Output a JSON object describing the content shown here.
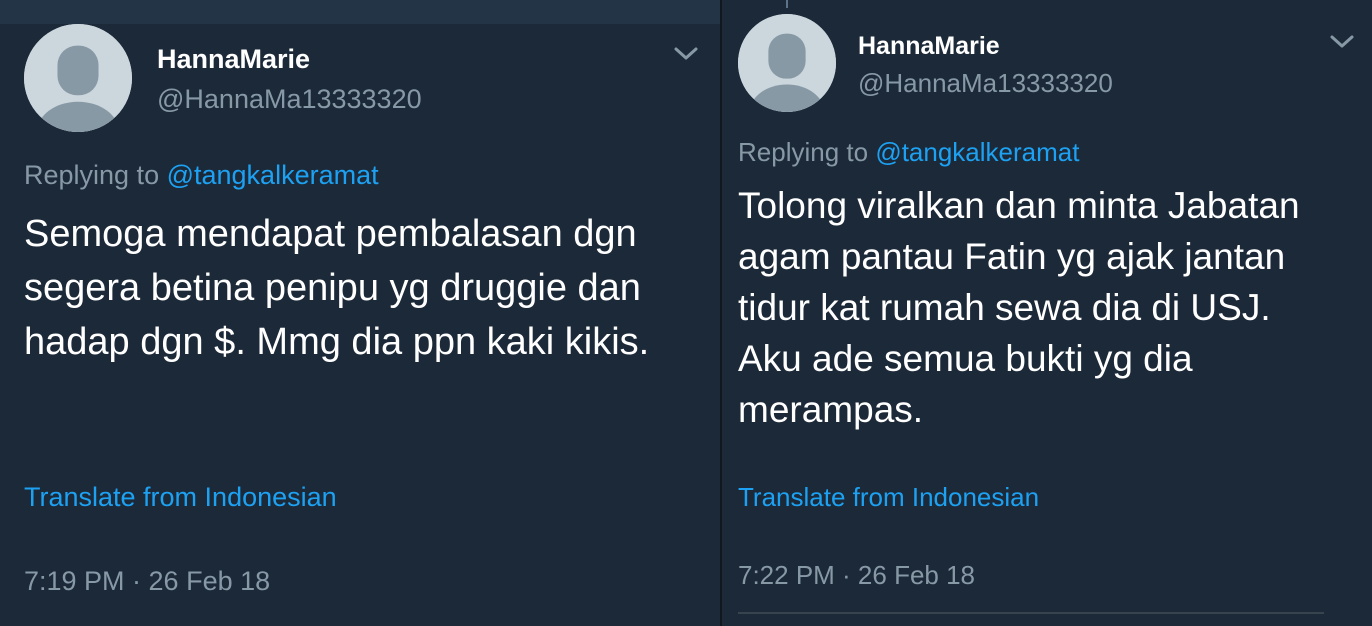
{
  "colors": {
    "background": "#1c2938",
    "text_primary": "#ffffff",
    "text_secondary": "#8899a6",
    "accent": "#1da1f2",
    "avatar_bg": "#ccd6dd",
    "avatar_fg": "#8899a6"
  },
  "tweets": [
    {
      "display_name": "HannaMarie",
      "handle": "@HannaMa13333320",
      "replying_prefix": "Replying to ",
      "replying_to": "@tangkalkeramat",
      "text": "Semoga mendapat pembalasan dgn segera betina penipu yg druggie dan hadap dgn $. Mmg dia ppn kaki kikis.",
      "translate_label": "Translate from Indonesian",
      "timestamp": "7:19 PM · 26 Feb 18",
      "avatar_icon": "default-profile-icon",
      "menu_icon": "chevron-down-icon"
    },
    {
      "display_name": "HannaMarie",
      "handle": "@HannaMa13333320",
      "replying_prefix": "Replying to ",
      "replying_to": "@tangkalkeramat",
      "text": "Tolong viralkan dan minta Jabatan agam pantau Fatin yg ajak jantan tidur kat rumah sewa dia di USJ. Aku ade semua bukti yg dia merampas.",
      "translate_label": "Translate from Indonesian",
      "timestamp": "7:22 PM · 26 Feb 18",
      "avatar_icon": "default-profile-icon",
      "menu_icon": "chevron-down-icon"
    }
  ]
}
